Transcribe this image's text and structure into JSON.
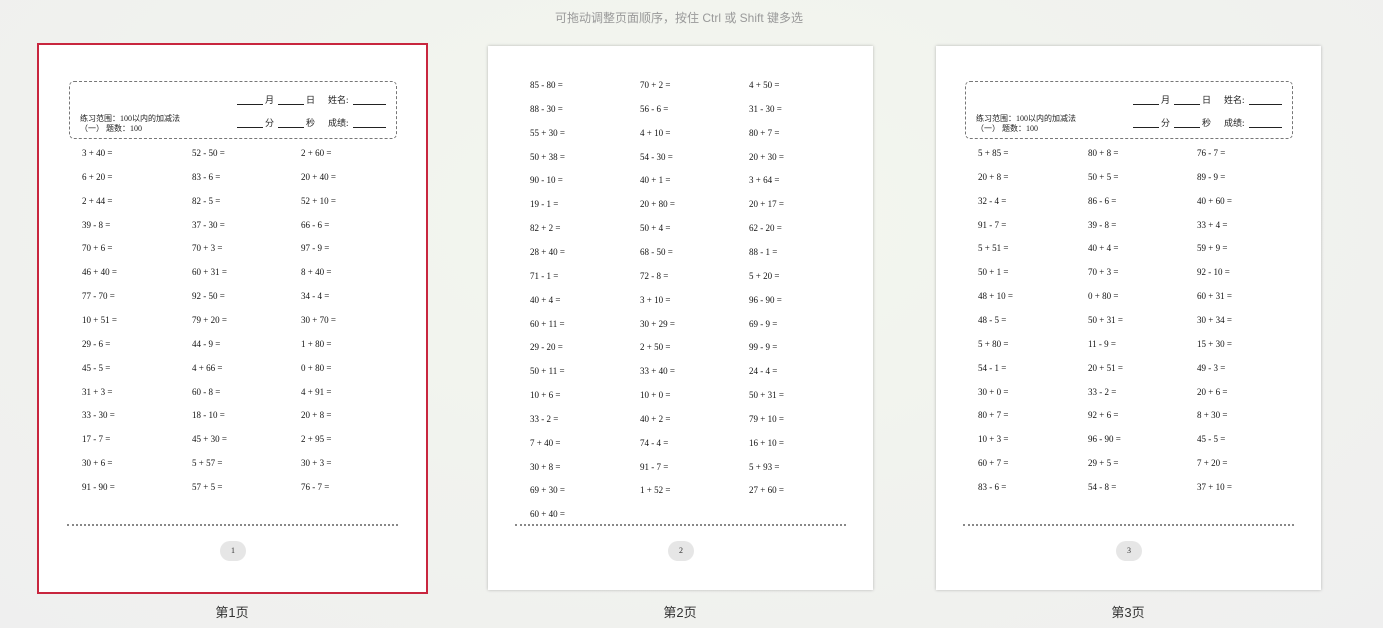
{
  "hint": "可拖动调整页面顺序，按住 Ctrl 或 Shift 键多选",
  "header": {
    "month": "月",
    "day": "日",
    "name": "姓名:",
    "minute": "分",
    "second": "秒",
    "score": "成绩:",
    "title_line1": "练习范围：100以内的加减法",
    "title_line2": "（一）  题数：100"
  },
  "pages": [
    {
      "number": "1",
      "caption": "第1页",
      "selected": true,
      "has_header": true,
      "columns": [
        [
          "3 + 40 =",
          "6 + 20 =",
          "2 + 44 =",
          "39 - 8 =",
          "70 + 6 =",
          "46 + 40 =",
          "77 - 70 =",
          "10 + 51 =",
          "29 - 6 =",
          "45 - 5 =",
          "31 + 3 =",
          "33 - 30 =",
          "17 - 7 =",
          "30 + 6 =",
          "91 - 90 ="
        ],
        [
          "52 - 50 =",
          "83 - 6 =",
          "82 - 5 =",
          "37 - 30 =",
          "70 + 3 =",
          "60 + 31 =",
          "92 - 50 =",
          "79 + 20 =",
          "44 - 9 =",
          "4 + 66 =",
          "60 - 8 =",
          "18 - 10 =",
          "45 + 30 =",
          "5 + 57 =",
          "57 + 5 ="
        ],
        [
          "2 + 60 =",
          "20 + 40 =",
          "52 + 10 =",
          "66 - 6 =",
          "97 - 9 =",
          "8 + 40 =",
          "34 - 4 =",
          "30 + 70 =",
          "1 + 80 =",
          "0 + 80 =",
          "4 + 91 =",
          "20 + 8 =",
          "2 + 95 =",
          "30 + 3 =",
          "76 - 7 ="
        ]
      ]
    },
    {
      "number": "2",
      "caption": "第2页",
      "selected": false,
      "has_header": false,
      "columns": [
        [
          "85 - 80 =",
          "88 - 30 =",
          "55 + 30 =",
          "50 + 38 =",
          "90 - 10 =",
          "19 - 1 =",
          "82 + 2 =",
          "28 + 40 =",
          "71 - 1 =",
          "40 + 4 =",
          "60 + 11 =",
          "29 - 20 =",
          "50 + 11 =",
          "10 + 6 =",
          "33 - 2 =",
          "7 + 40 =",
          "30 + 8 =",
          "69 + 30 =",
          "60 + 40 ="
        ],
        [
          "70 + 2 =",
          "56 - 6 =",
          "4 + 10 =",
          "54 - 30 =",
          "40 + 1 =",
          "20 + 80 =",
          "50 + 4 =",
          "68 - 50 =",
          "72 - 8 =",
          "3 + 10 =",
          "30 + 29 =",
          "2 + 50 =",
          "33 + 40 =",
          "10 + 0 =",
          "40 + 2 =",
          "74 - 4 =",
          "91 - 7 =",
          "1 + 52 ="
        ],
        [
          "4 + 50 =",
          "31 - 30 =",
          "80 + 7 =",
          "20 + 30 =",
          "3 + 64 =",
          "20 + 17 =",
          "62 - 20 =",
          "88 - 1 =",
          "5 + 20 =",
          "96 - 90 =",
          "69 - 9 =",
          "99 - 9 =",
          "24 - 4 =",
          "50 + 31 =",
          "79 + 10 =",
          "16 + 10 =",
          "5 + 93 =",
          "27 + 60 ="
        ]
      ]
    },
    {
      "number": "3",
      "caption": "第3页",
      "selected": false,
      "has_header": true,
      "columns": [
        [
          "5 + 85 =",
          "20 + 8 =",
          "32 - 4 =",
          "91 - 7 =",
          "5 + 51 =",
          "50 + 1 =",
          "48 + 10 =",
          "48 - 5 =",
          "5 + 80 =",
          "54 - 1 =",
          "30 + 0 =",
          "80 + 7 =",
          "10 + 3 =",
          "60 + 7 =",
          "83 - 6 ="
        ],
        [
          "80 + 8 =",
          "50 + 5 =",
          "86 - 6 =",
          "39 - 8 =",
          "40 + 4 =",
          "70 + 3 =",
          "0 + 80 =",
          "50 + 31 =",
          "11 - 9 =",
          "20 + 51 =",
          "33 - 2 =",
          "92 + 6 =",
          "96 - 90 =",
          "29 + 5 =",
          "54 - 8 ="
        ],
        [
          "76 - 7 =",
          "89 - 9 =",
          "40 + 60 =",
          "33 + 4 =",
          "59 + 9 =",
          "92 - 10 =",
          "60 + 31 =",
          "30 + 34 =",
          "15 + 30 =",
          "49 - 3 =",
          "20 + 6 =",
          "8 + 30 =",
          "45 - 5 =",
          "7 + 20 =",
          "37 + 10 ="
        ]
      ]
    }
  ]
}
